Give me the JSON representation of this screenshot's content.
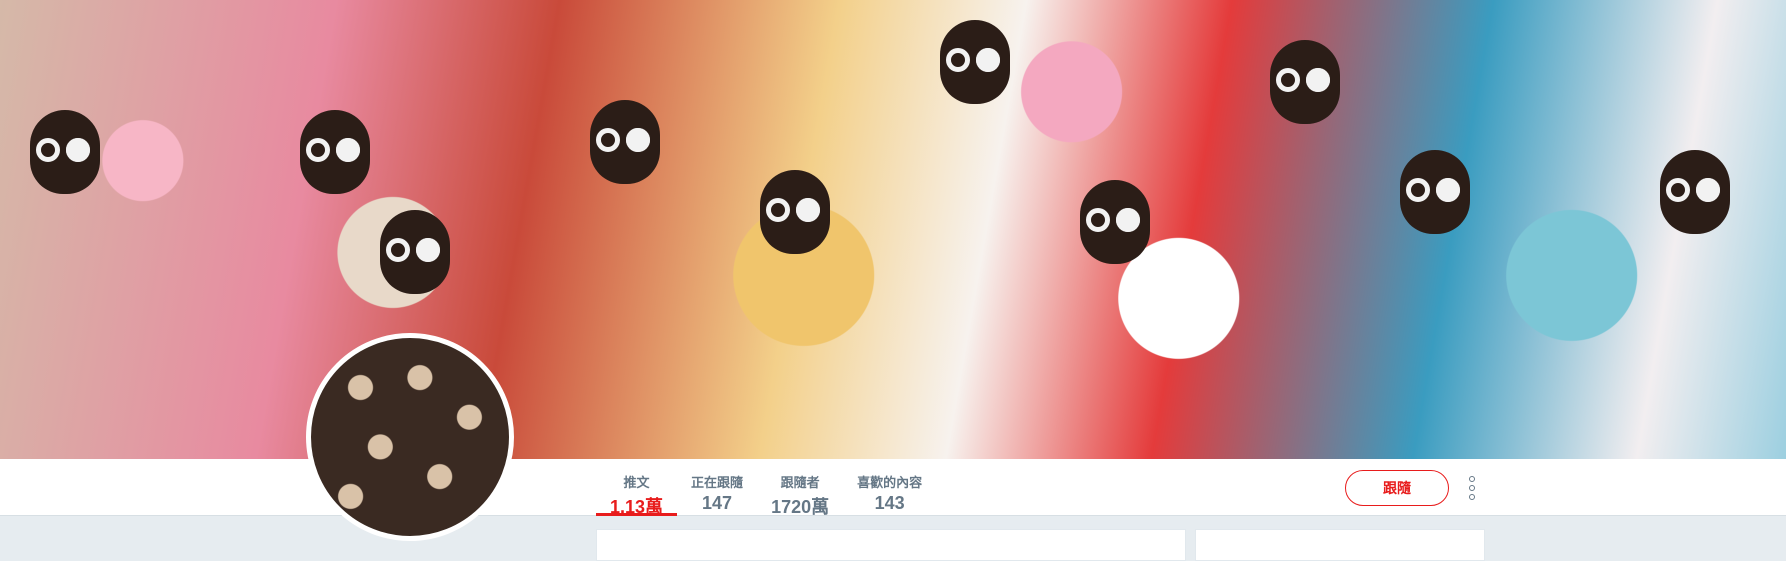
{
  "profile": {
    "follow_label": "跟隨"
  },
  "nav": {
    "items": [
      {
        "label": "推文",
        "value": "1.13萬"
      },
      {
        "label": "正在跟隨",
        "value": "147"
      },
      {
        "label": "跟隨者",
        "value": "1720萬"
      },
      {
        "label": "喜歡的內容",
        "value": "143"
      }
    ]
  },
  "colors": {
    "accent": "#e81c1c",
    "muted_text": "#657786",
    "page_background": "#e6ecf0"
  },
  "icons": {
    "more": "more-vertical-icon"
  }
}
